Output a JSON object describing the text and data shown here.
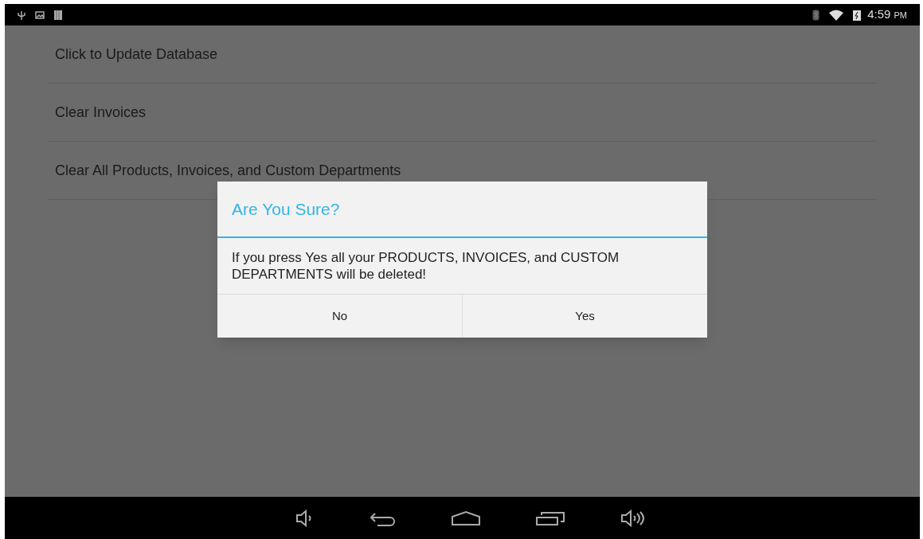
{
  "status_bar": {
    "time": "4:59",
    "am_pm": "PM"
  },
  "settings_list": [
    {
      "label": "Click to Update Database"
    },
    {
      "label": "Clear Invoices"
    },
    {
      "label": "Clear All Products, Invoices, and Custom Departments"
    }
  ],
  "dialog": {
    "title": "Are You Sure?",
    "message": "If you press Yes all your PRODUCTS, INVOICES, and CUSTOM DEPARTMENTS will be deleted!",
    "buttons": [
      "No",
      "Yes"
    ]
  }
}
